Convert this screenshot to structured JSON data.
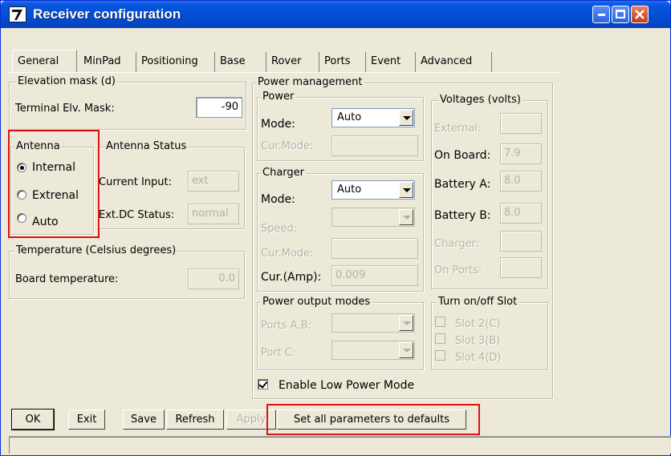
{
  "window": {
    "title": "Receiver configuration",
    "controls": {
      "minimize": "_",
      "maximize": "□",
      "close": "✕"
    }
  },
  "tabs": [
    {
      "label": "General",
      "active": true
    },
    {
      "label": "MinPad"
    },
    {
      "label": "Positioning"
    },
    {
      "label": "Base"
    },
    {
      "label": "Rover"
    },
    {
      "label": "Ports"
    },
    {
      "label": "Event"
    },
    {
      "label": "Advanced"
    }
  ],
  "elevation": {
    "legend": "Elevation mask (d)",
    "label": "Terminal Elv. Mask:",
    "value": "-90"
  },
  "antenna": {
    "legend": "Antenna",
    "options": [
      {
        "label": "Internal",
        "selected": true
      },
      {
        "label": "Extrenal",
        "selected": false
      },
      {
        "label": "Auto",
        "selected": false
      }
    ]
  },
  "antenna_status": {
    "legend": "Antenna Status",
    "current_input_label": "Current Input:",
    "current_input_value": "ext",
    "dc_status_label": "Ext.DC Status:",
    "dc_status_value": "normal"
  },
  "temperature": {
    "legend": "Temperature (Celsius degrees)",
    "label": "Board temperature:",
    "value": "0.0"
  },
  "power_management": {
    "legend": "Power management",
    "power": {
      "legend": "Power",
      "mode_label": "Mode:",
      "mode_value": "Auto",
      "cur_mode_label": "Cur.Mode:",
      "cur_mode_value": ""
    },
    "charger": {
      "legend": "Charger",
      "mode_label": "Mode:",
      "mode_value": "Auto",
      "speed_label": "Speed:",
      "speed_value": "",
      "cur_mode_label": "Cur.Mode:",
      "cur_mode_value": "",
      "cur_amp_label": "Cur.(Amp):",
      "cur_amp_value": "0.009"
    },
    "voltages": {
      "legend": "Voltages (volts)",
      "external_label": "External:",
      "external_value": "",
      "onboard_label": "On Board:",
      "onboard_value": "7.9",
      "battery_a_label": "Battery A:",
      "battery_a_value": "8.0",
      "battery_b_label": "Battery B:",
      "battery_b_value": "8.0",
      "charger_label": "Charger:",
      "charger_value": "",
      "on_ports_label": "On Ports:",
      "on_ports_value": ""
    },
    "output_modes": {
      "legend": "Power output modes",
      "ports_ab_label": "Ports A,B:",
      "port_c_label": "Port C:"
    },
    "slots": {
      "legend": "Turn on/off Slot",
      "items": [
        "Slot 2(C)",
        "Slot 3(B)",
        "Slot 4(D)"
      ]
    },
    "low_power": {
      "label": "Enable Low Power Mode",
      "checked": true
    }
  },
  "buttons": {
    "ok": "OK",
    "exit": "Exit",
    "save": "Save",
    "refresh": "Refresh",
    "apply": "Apply",
    "defaults": "Set all parameters to defaults"
  },
  "colors": {
    "titlebar": "#0450d8",
    "dialog_bg": "#ece9d8",
    "highlight": "#e01010",
    "disabled_text": "#b5b2a5"
  }
}
